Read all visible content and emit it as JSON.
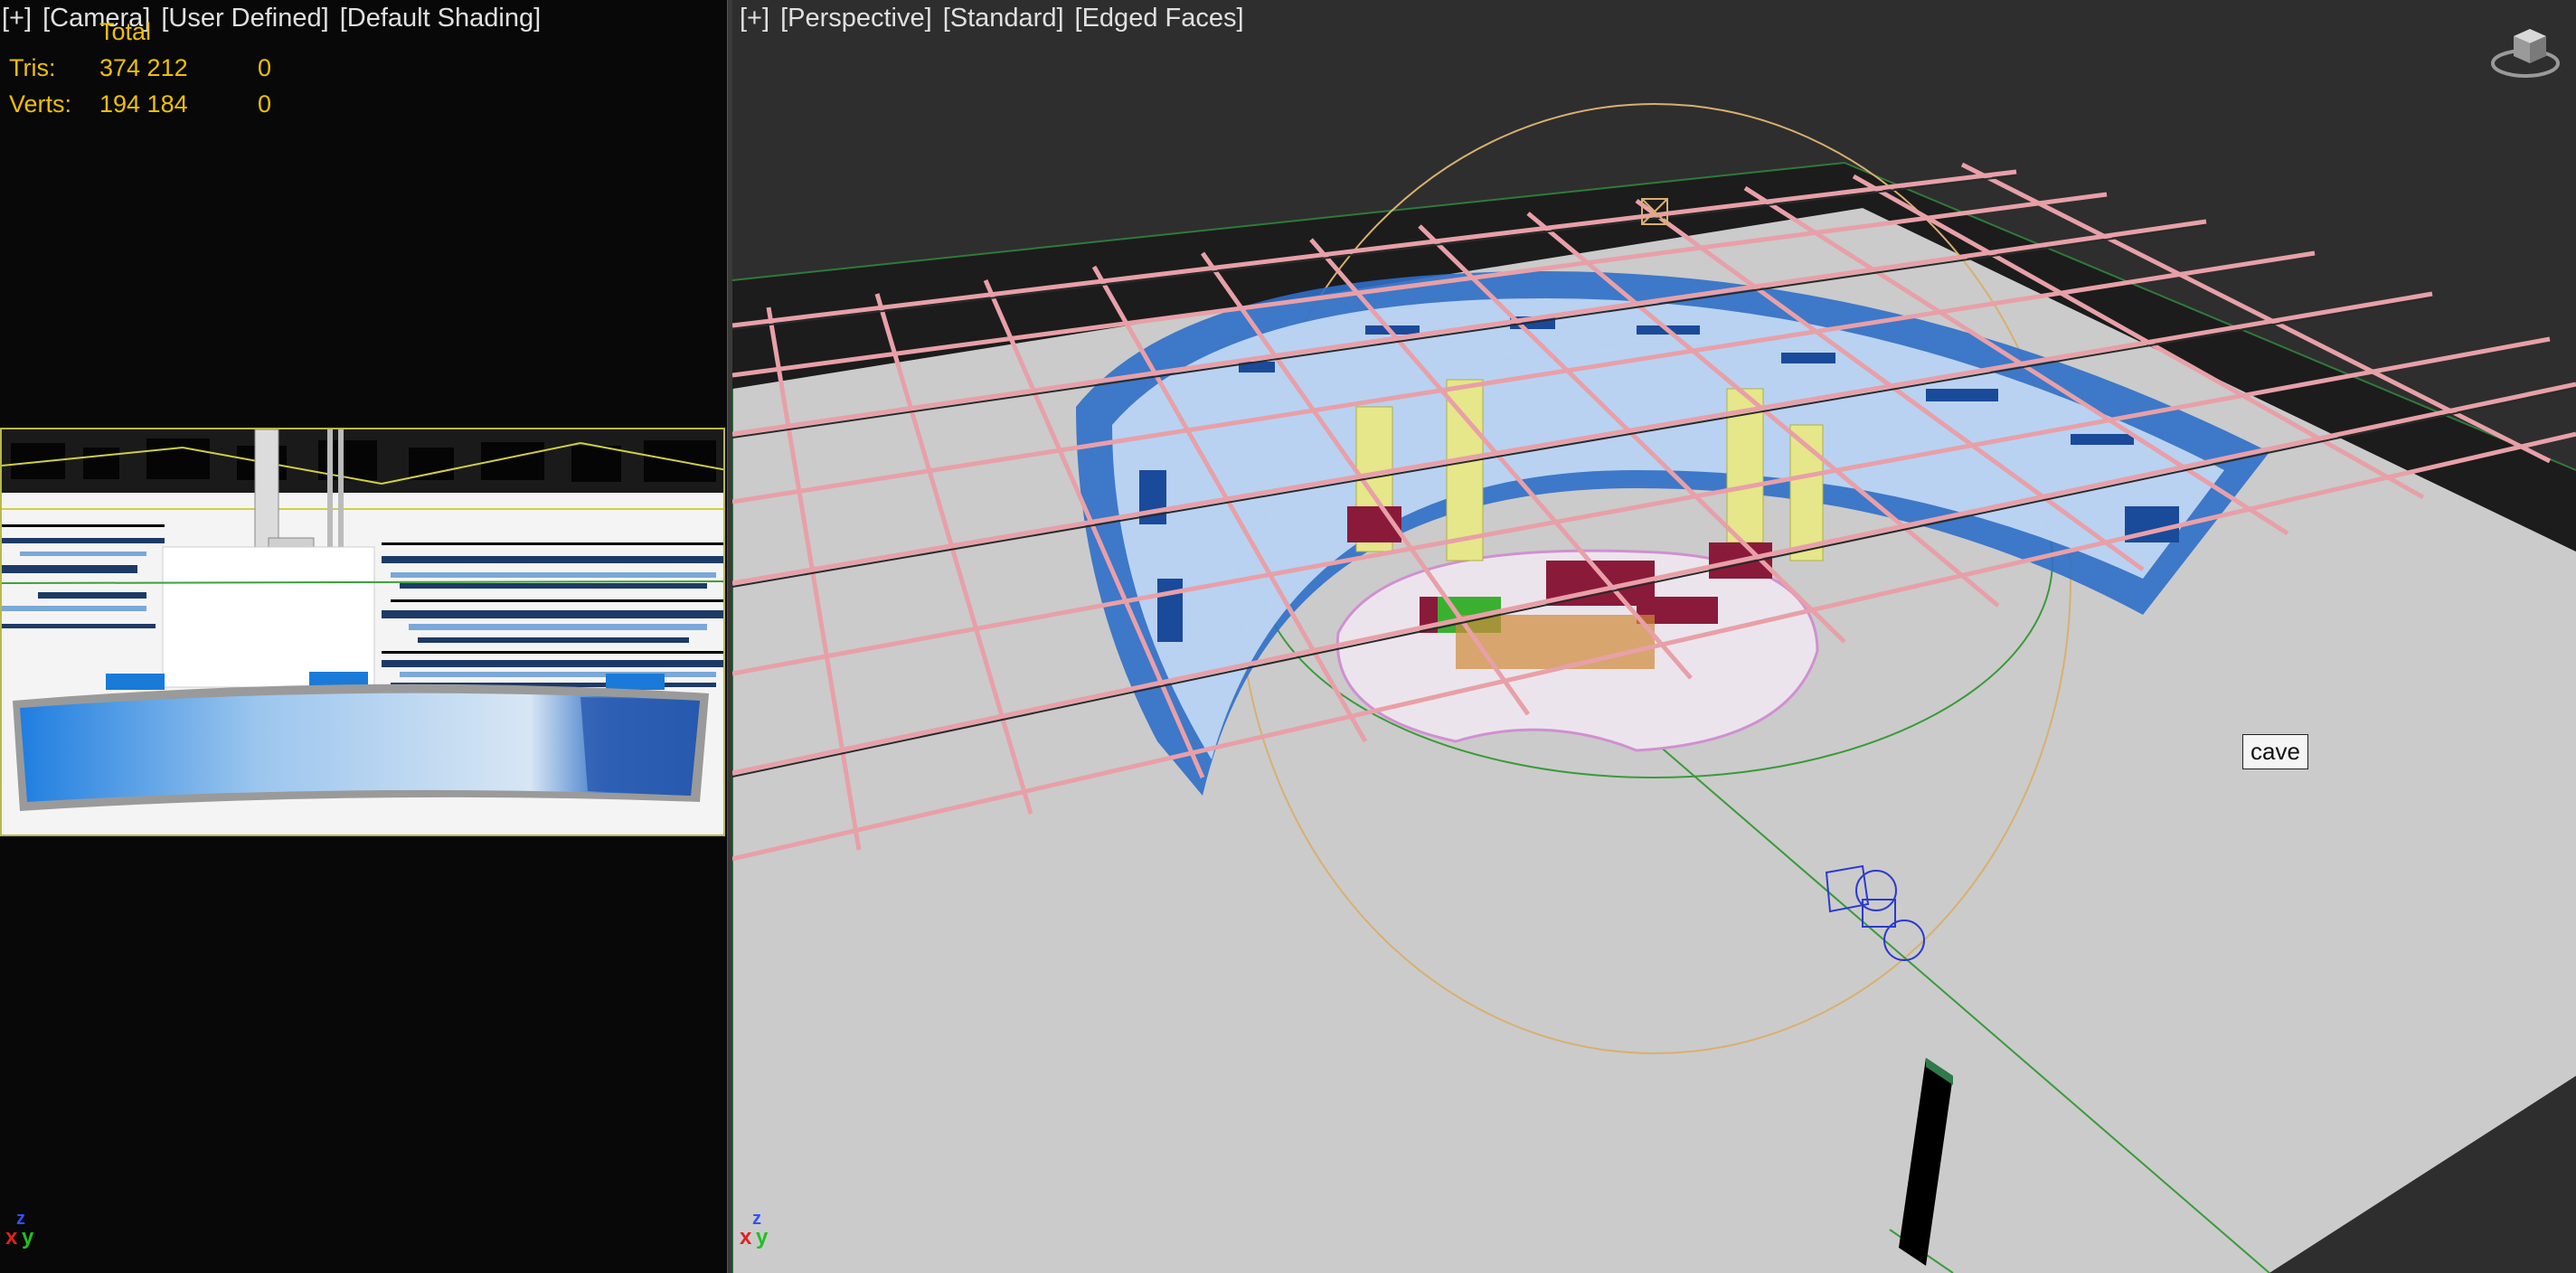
{
  "left_viewport": {
    "label_parts": [
      "[+]",
      "[Camera]",
      "[User Defined]",
      "[Default Shading]"
    ],
    "stats": {
      "total_label": "Total",
      "rows": [
        {
          "label": "Tris:",
          "total": "374 212",
          "selected": "0"
        },
        {
          "label": "Verts:",
          "total": "194 184",
          "selected": "0"
        }
      ]
    },
    "axis": {
      "x": "x",
      "y": "y",
      "z": "z"
    }
  },
  "right_viewport": {
    "label_parts": [
      "[+]",
      "[Perspective]",
      "[Standard]",
      "[Edged Faces]"
    ],
    "tooltip": "cave",
    "axis": {
      "x": "x",
      "y": "y",
      "z": "z"
    },
    "viewcube_icon": "viewcube-icon"
  },
  "colors": {
    "stats_text": "#f0c000",
    "grid_pink": "#e8a0a8",
    "floor": "#c8c8c8",
    "blue_mesh": "#3a7fd0",
    "camera_frame": "#b8b84a"
  }
}
